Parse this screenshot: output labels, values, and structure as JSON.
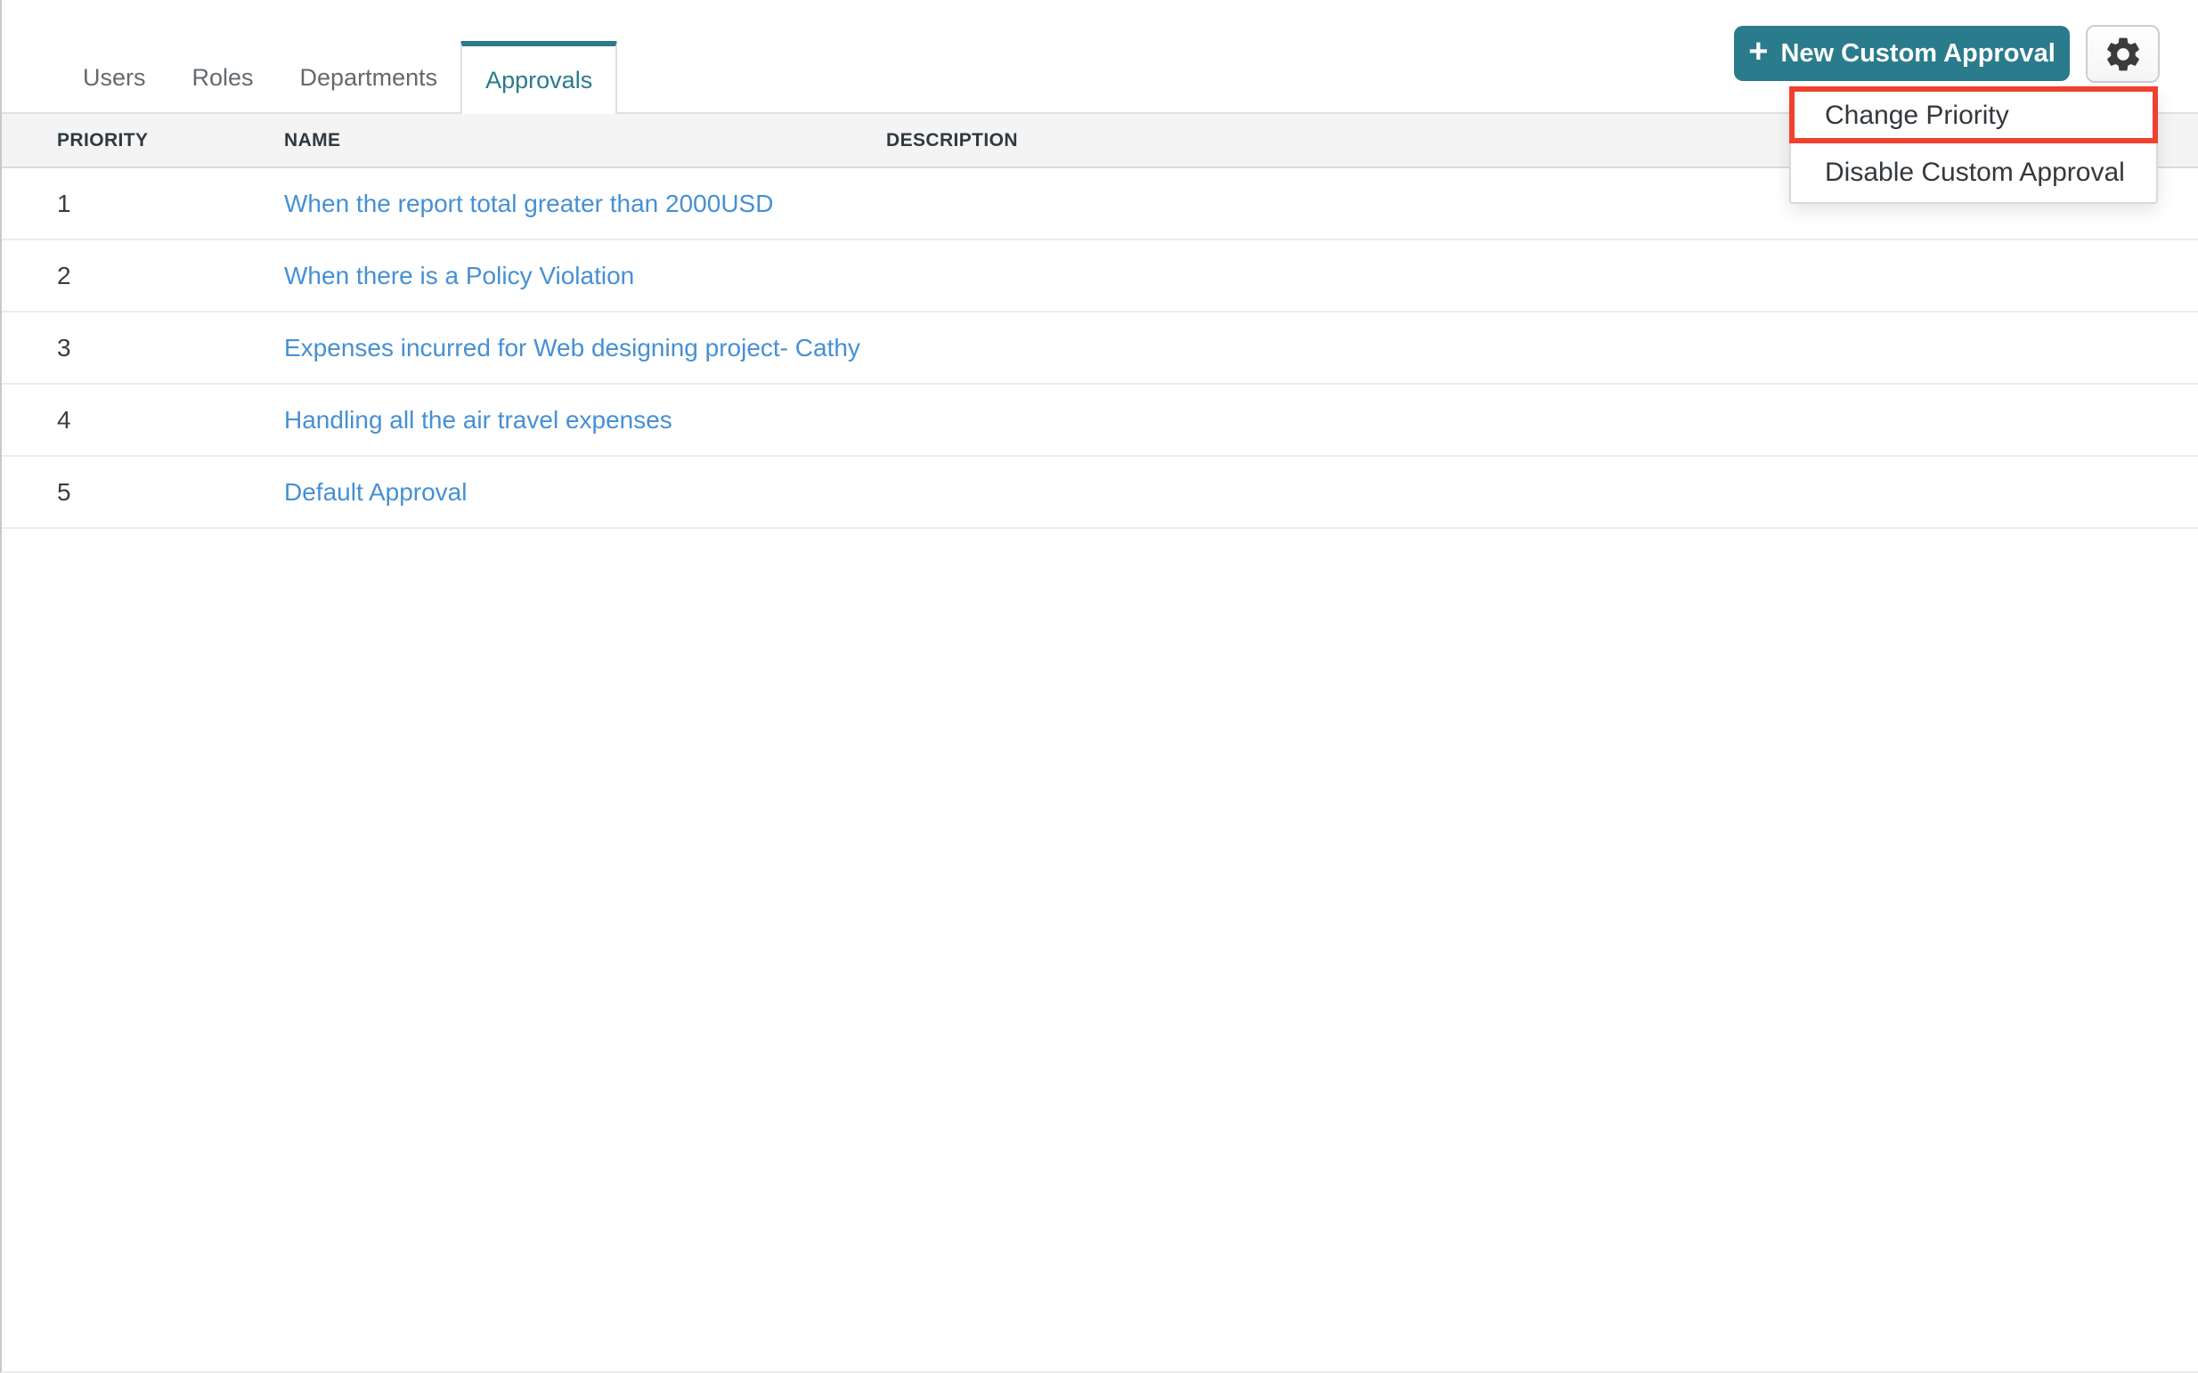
{
  "colors": {
    "accent": "#2a7b8c",
    "link": "#4690d4",
    "highlight": "#f0402f",
    "header-bg": "#f4f4f5",
    "border": "#e0e0e0",
    "tab-inactive": "#63696e",
    "text-dark": "#383d42",
    "menu-text": "#33383d"
  },
  "tabs": {
    "items": [
      {
        "label": "Users",
        "active": false
      },
      {
        "label": "Roles",
        "active": false
      },
      {
        "label": "Departments",
        "active": false
      },
      {
        "label": "Approvals",
        "active": true
      }
    ]
  },
  "toolbar": {
    "new_button_label": "New Custom Approval",
    "plus_icon": "+",
    "settings_icon": "gear"
  },
  "menu": {
    "items": [
      {
        "label": "Change Priority",
        "highlighted": true
      },
      {
        "label": "Disable Custom Approval",
        "highlighted": false
      }
    ]
  },
  "table": {
    "columns": [
      {
        "label": "PRIORITY"
      },
      {
        "label": "NAME"
      },
      {
        "label": "DESCRIPTION"
      }
    ],
    "rows": [
      {
        "priority": "1",
        "name": "When the report total greater than 2000USD",
        "description": ""
      },
      {
        "priority": "2",
        "name": "When there is a Policy Violation",
        "description": ""
      },
      {
        "priority": "3",
        "name": "Expenses incurred for Web designing project- Cathy",
        "description": ""
      },
      {
        "priority": "4",
        "name": "Handling all the air travel expenses",
        "description": ""
      },
      {
        "priority": "5",
        "name": "Default Approval",
        "description": ""
      }
    ]
  }
}
